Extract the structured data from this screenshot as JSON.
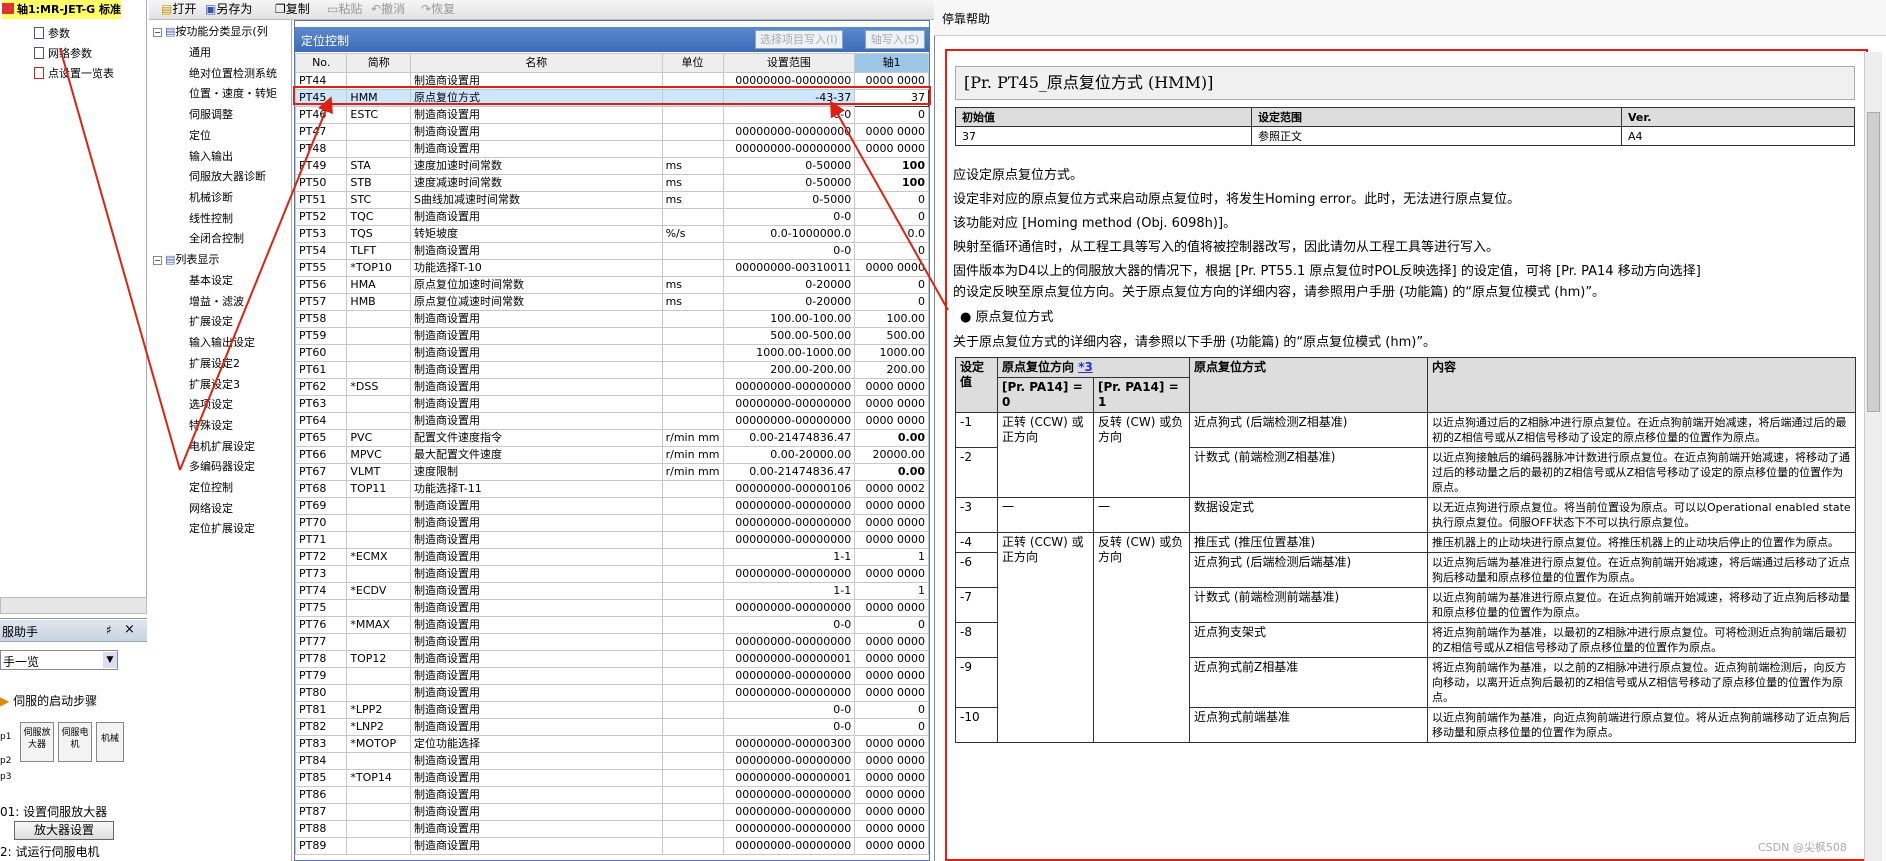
{
  "project_tree": {
    "root": "轴1:MR-JET-G 标准",
    "items": [
      "参数",
      "网络参数",
      "点设置一览表"
    ]
  },
  "toolbar": {
    "open": "打开",
    "save_as": "另存为",
    "copy": "复制",
    "paste": "粘贴",
    "undo": "撤消",
    "redo": "恢复"
  },
  "categories": {
    "group1": "按功能分类显示(列",
    "group1_items": [
      "通用",
      "绝对位置检测系统",
      "位置・速度・转矩",
      "伺服调整",
      "定位",
      "输入输出",
      "伺服放大器诊断",
      "机械诊断",
      "线性控制",
      "全闭合控制"
    ],
    "group2": "列表显示",
    "group2_items": [
      "基本设定",
      "增益・滤波",
      "扩展设定",
      "输入输出设定",
      "扩展设定2",
      "扩展设定3",
      "选项设定",
      "特殊设定",
      "电机扩展设定",
      "多编码器设定",
      "定位控制",
      "网络设定",
      "定位扩展设定"
    ]
  },
  "main": {
    "title": "定位控制",
    "btn_write_selected": "选择项目写入(I)",
    "btn_axis_write": "轴写入(S)",
    "columns": [
      "No.",
      "简称",
      "名称",
      "单位",
      "设置范围",
      "轴1"
    ],
    "rows": [
      [
        "PT44",
        "",
        "制造商设置用",
        "",
        "00000000-00000000",
        "0000 0000"
      ],
      [
        "PT45",
        "HMM",
        "原点复位方式",
        "",
        "-43-37",
        "37"
      ],
      [
        "PT46",
        "ESTC",
        "制造商设置用",
        "",
        "0-0",
        "0"
      ],
      [
        "PT47",
        "",
        "制造商设置用",
        "",
        "00000000-00000000",
        "0000 0000"
      ],
      [
        "PT48",
        "",
        "制造商设置用",
        "",
        "00000000-00000000",
        "0000 0000"
      ],
      [
        "PT49",
        "STA",
        "速度加速时间常数",
        "ms",
        "0-50000",
        "100"
      ],
      [
        "PT50",
        "STB",
        "速度减速时间常数",
        "ms",
        "0-50000",
        "100"
      ],
      [
        "PT51",
        "STC",
        "S曲线加减速时间常数",
        "ms",
        "0-5000",
        "0"
      ],
      [
        "PT52",
        "TQC",
        "制造商设置用",
        "",
        "0-0",
        "0"
      ],
      [
        "PT53",
        "TQS",
        "转矩坡度",
        "%/s",
        "0.0-1000000.0",
        "0.0"
      ],
      [
        "PT54",
        "TLFT",
        "制造商设置用",
        "",
        "0-0",
        "0"
      ],
      [
        "PT55",
        "*TOP10",
        "功能选择T-10",
        "",
        "00000000-00310011",
        "0000 0000"
      ],
      [
        "PT56",
        "HMA",
        "原点复位加速时间常数",
        "ms",
        "0-20000",
        "0"
      ],
      [
        "PT57",
        "HMB",
        "原点复位减速时间常数",
        "ms",
        "0-20000",
        "0"
      ],
      [
        "PT58",
        "",
        "制造商设置用",
        "",
        "100.00-100.00",
        "100.00"
      ],
      [
        "PT59",
        "",
        "制造商设置用",
        "",
        "500.00-500.00",
        "500.00"
      ],
      [
        "PT60",
        "",
        "制造商设置用",
        "",
        "1000.00-1000.00",
        "1000.00"
      ],
      [
        "PT61",
        "",
        "制造商设置用",
        "",
        "200.00-200.00",
        "200.00"
      ],
      [
        "PT62",
        "*DSS",
        "制造商设置用",
        "",
        "00000000-00000000",
        "0000 0000"
      ],
      [
        "PT63",
        "",
        "制造商设置用",
        "",
        "00000000-00000000",
        "0000 0000"
      ],
      [
        "PT64",
        "",
        "制造商设置用",
        "",
        "00000000-00000000",
        "0000 0000"
      ],
      [
        "PT65",
        "PVC",
        "配置文件速度指令",
        "r/min mm",
        "0.00-21474836.47",
        "0.00"
      ],
      [
        "PT66",
        "MPVC",
        "最大配置文件速度",
        "r/min mm",
        "0.00-20000.00",
        "20000.00"
      ],
      [
        "PT67",
        "VLMT",
        "速度限制",
        "r/min mm",
        "0.00-21474836.47",
        "0.00"
      ],
      [
        "PT68",
        "TOP11",
        "功能选择T-11",
        "",
        "00000000-00000106",
        "0000 0002"
      ],
      [
        "PT69",
        "",
        "制造商设置用",
        "",
        "00000000-00000000",
        "0000 0000"
      ],
      [
        "PT70",
        "",
        "制造商设置用",
        "",
        "00000000-00000000",
        "0000 0000"
      ],
      [
        "PT71",
        "",
        "制造商设置用",
        "",
        "00000000-00000000",
        "0000 0000"
      ],
      [
        "PT72",
        "*ECMX",
        "制造商设置用",
        "",
        "1-1",
        "1"
      ],
      [
        "PT73",
        "",
        "制造商设置用",
        "",
        "00000000-00000000",
        "0000 0000"
      ],
      [
        "PT74",
        "*ECDV",
        "制造商设置用",
        "",
        "1-1",
        "1"
      ],
      [
        "PT75",
        "",
        "制造商设置用",
        "",
        "00000000-00000000",
        "0000 0000"
      ],
      [
        "PT76",
        "*MMAX",
        "制造商设置用",
        "",
        "0-0",
        "0"
      ],
      [
        "PT77",
        "",
        "制造商设置用",
        "",
        "00000000-00000000",
        "0000 0000"
      ],
      [
        "PT78",
        "TOP12",
        "制造商设置用",
        "",
        "00000000-00000001",
        "0000 0000"
      ],
      [
        "PT79",
        "",
        "制造商设置用",
        "",
        "00000000-00000000",
        "0000 0000"
      ],
      [
        "PT80",
        "",
        "制造商设置用",
        "",
        "00000000-00000000",
        "0000 0000"
      ],
      [
        "PT81",
        "*LPP2",
        "制造商设置用",
        "",
        "0-0",
        "0"
      ],
      [
        "PT82",
        "*LNP2",
        "制造商设置用",
        "",
        "0-0",
        "0"
      ],
      [
        "PT83",
        "*MOTOP",
        "定位功能选择",
        "",
        "00000000-00000300",
        "0000 0000"
      ],
      [
        "PT84",
        "",
        "制造商设置用",
        "",
        "00000000-00000000",
        "0000 0000"
      ],
      [
        "PT85",
        "*TOP14",
        "制造商设置用",
        "",
        "00000000-00000001",
        "0000 0000"
      ],
      [
        "PT86",
        "",
        "制造商设置用",
        "",
        "00000000-00000000",
        "0000 0000"
      ],
      [
        "PT87",
        "",
        "制造商设置用",
        "",
        "00000000-00000000",
        "0000 0000"
      ],
      [
        "PT88",
        "",
        "制造商设置用",
        "",
        "00000000-00000000",
        "0000 0000"
      ],
      [
        "PT89",
        "",
        "制造商设置用",
        "",
        "00000000-00000000",
        "0000 0000"
      ]
    ]
  },
  "helper": {
    "title": "服助手",
    "pin": "♯",
    "close": "×",
    "dropdown": "手一览",
    "startup": "伺服的启动步骤",
    "diagram_labels": [
      "伺服放大器",
      "伺服电机",
      "机械"
    ],
    "markers": [
      "p1",
      "p2",
      "p3"
    ],
    "step1": "01: 设置伺服放大器",
    "step1_btn": "放大器设置",
    "step2": "2: 试运行伺服电机"
  },
  "help": {
    "window_title": "停靠帮助",
    "heading": "[Pr. PT45_原点复位方式 (HMM)]",
    "info_headers": [
      "初始值",
      "设定范围",
      "Ver."
    ],
    "info_values": [
      "37",
      "参照正文",
      "A4"
    ],
    "paras": [
      "应设定原点复位方式。",
      "设定非对应的原点复位方式来启动原点复位时，将发生Homing error。此时，无法进行原点复位。",
      "该功能对应 [Homing method (Obj. 6098h)]。",
      "映射至循环通信时，从工程工具等写入的值将被控制器改写，因此请勿从工程工具等进行写入。",
      "固件版本为D4以上的伺服放大器的情况下，根据 [Pr. PT55.1 原点复位时POL反映选择] 的设定值，可将 [Pr. PA14 移动方向选择]",
      "的设定反映至原点复位方向。关于原点复位方向的详细内容，请参照用户手册 (功能篇) 的“原点复位模式 (hm)”。"
    ],
    "bullet": "原点复位方式",
    "ref": "关于原点复位方式的详细内容，请参照以下手册 (功能篇) 的“原点复位模式 (hm)”。",
    "table_headers": {
      "setting": "设定值",
      "direction": "原点复位方向",
      "note": "*3",
      "pa14_0": "[Pr. PA14] = 0",
      "pa14_1": "[Pr. PA14] = 1",
      "method": "原点复位方式",
      "content": "内容"
    },
    "table_rows": [
      {
        "v": "-1",
        "d0": "正转 (CCW) 或正方向",
        "d1": "反转 (CW) 或负方向",
        "m": "近点狗式 (后端检测Z相基准)",
        "c": "以近点狗通过后的Z相脉冲进行原点复位。在近点狗前端开始减速，将后端通过后的最初的Z相信号或从Z相信号移动了设定的原点移位量的位置作为原点。"
      },
      {
        "v": "-2",
        "d0": "",
        "d1": "",
        "m": "计数式 (前端检测Z相基准)",
        "c": "以近点狗接触后的编码器脉冲计数进行原点复位。在近点狗前端开始减速，将移动了通过后的移动量之后的最初的Z相信号或从Z相信号移动了设定的原点移位量的位置作为原点。"
      },
      {
        "v": "-3",
        "d0": "一",
        "d1": "一",
        "m": "数据设定式",
        "c": "以无近点狗进行原点复位。将当前位置设为原点。可以以Operational enabled state执行原点复位。伺服OFF状态下不可以执行原点复位。"
      },
      {
        "v": "-4",
        "d0": "正转 (CCW) 或正方向",
        "d1": "反转 (CW) 或负方向",
        "m": "推压式 (推压位置基准)",
        "c": "推压机器上的止动块进行原点复位。将推压机器上的止动块后停止的位置作为原点。"
      },
      {
        "v": "-6",
        "d0": "",
        "d1": "",
        "m": "近点狗式 (后端检测后端基准)",
        "c": "以近点狗后端为基准进行原点复位。在近点狗前端开始减速，将后端通过后移动了近点狗后移动量和原点移位量的位置作为原点。"
      },
      {
        "v": "-7",
        "d0": "",
        "d1": "",
        "m": "计数式 (前端检测前端基准)",
        "c": "以近点狗前端为基准进行原点复位。在近点狗前端开始减速，将移动了近点狗后移动量和原点移位量的位置作为原点。"
      },
      {
        "v": "-8",
        "d0": "",
        "d1": "",
        "m": "近点狗支架式",
        "c": "将近点狗前端作为基准，以最初的Z相脉冲进行原点复位。可将检测近点狗前端后最初的Z相信号或从Z相信号移动了原点移位量的位置作为原点。"
      },
      {
        "v": "-9",
        "d0": "",
        "d1": "",
        "m": "近点狗式前Z相基准",
        "c": "将近点狗前端作为基准，以之前的Z相脉冲进行原点复位。近点狗前端检测后，向反方向移动，以离开近点狗后最初的Z相信号或从Z相信号移动了原点移位量的位置作为原点。"
      },
      {
        "v": "-10",
        "d0": "",
        "d1": "",
        "m": "近点狗式前端基准",
        "c": "以近点狗前端作为基准，向近点狗前端进行原点复位。将从近点狗前端移动了近点狗后移动量和原点移位量的位置作为原点。"
      }
    ],
    "watermark": "CSDN @尖枫508"
  },
  "colors": {
    "highlight": "#d21",
    "selected_row": "#cde6fb",
    "header_blue": "#3d6bb8"
  }
}
